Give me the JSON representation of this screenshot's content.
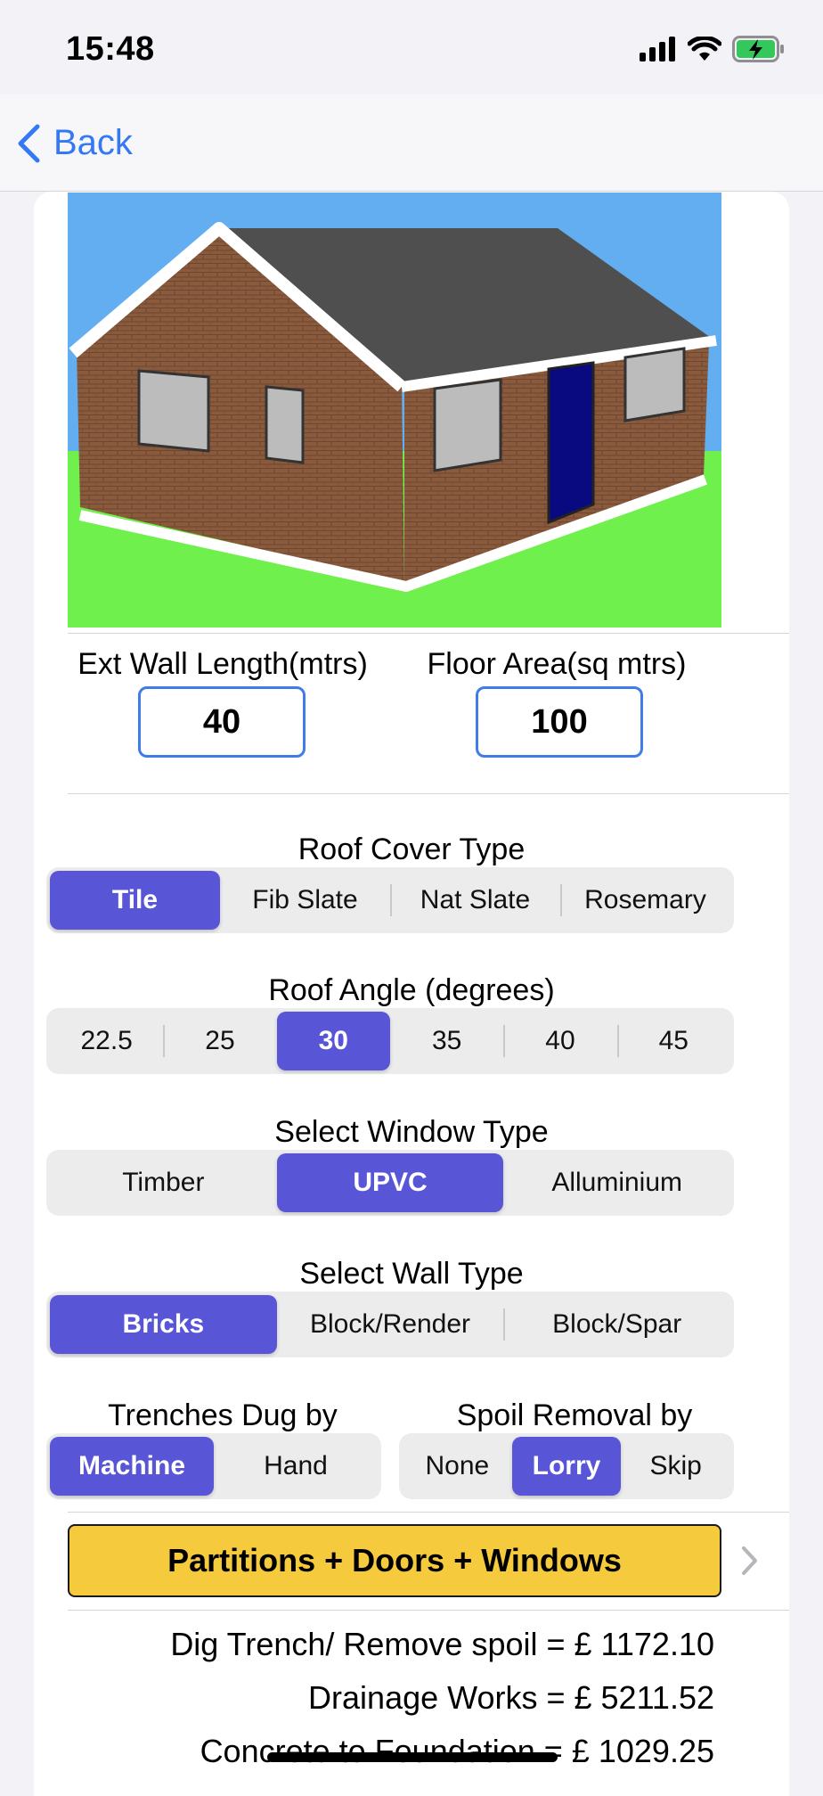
{
  "status_bar": {
    "time": "15:48"
  },
  "nav": {
    "back_label": "Back"
  },
  "inputs": {
    "ext_wall_label": "Ext Wall Length(mtrs)",
    "ext_wall_value": "40",
    "floor_area_label": "Floor Area(sq mtrs)",
    "floor_area_value": "100"
  },
  "roof_cover": {
    "title": "Roof Cover Type",
    "options": [
      "Tile",
      "Fib Slate",
      "Nat Slate",
      "Rosemary"
    ],
    "selected": "Tile"
  },
  "roof_angle": {
    "title": "Roof Angle (degrees)",
    "options": [
      "22.5",
      "25",
      "30",
      "35",
      "40",
      "45"
    ],
    "selected": "30"
  },
  "window_type": {
    "title": "Select Window Type",
    "options": [
      "Timber",
      "UPVC",
      "Alluminium"
    ],
    "selected": "UPVC"
  },
  "wall_type": {
    "title": "Select Wall Type",
    "options": [
      "Bricks",
      "Block/Render",
      "Block/Spar"
    ],
    "selected": "Bricks"
  },
  "trenches": {
    "title": "Trenches Dug by",
    "options": [
      "Machine",
      "Hand"
    ],
    "selected": "Machine"
  },
  "spoil": {
    "title": "Spoil Removal by",
    "options": [
      "None",
      "Lorry",
      "Skip"
    ],
    "selected": "Lorry"
  },
  "partitions_button": "Partitions + Doors + Windows",
  "costs": [
    "Dig Trench/ Remove spoil = £ 1172.10",
    "Drainage Works = £ 5211.52",
    "Concrete to Foundation = £ 1029.25"
  ],
  "colors": {
    "accent": "#5856d6",
    "link": "#3478f6",
    "button_yellow": "#f5ca3c",
    "input_border": "#3f7ce8"
  }
}
